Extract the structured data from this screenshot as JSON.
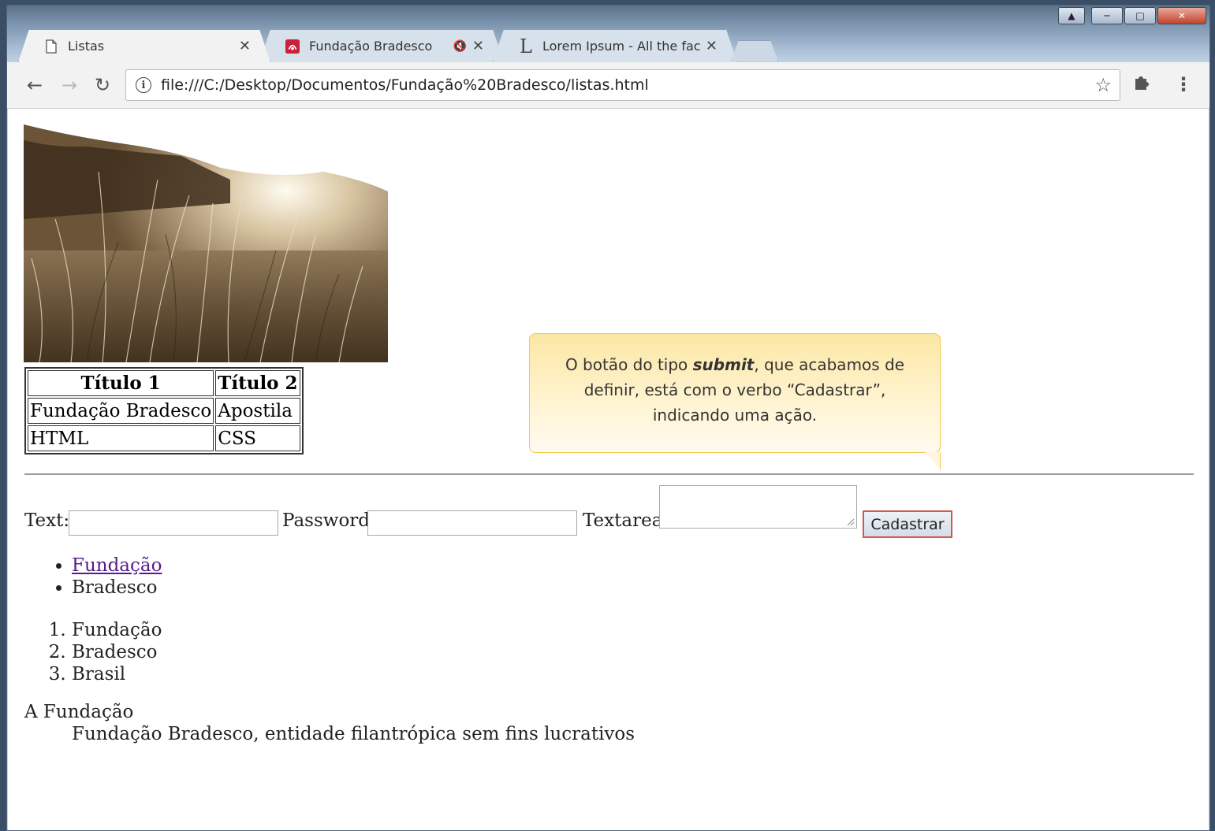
{
  "browser": {
    "tabs": [
      {
        "title": "Listas",
        "icon": "document-icon",
        "active": true
      },
      {
        "title": "Fundação Bradesco",
        "icon": "bradesco-icon",
        "muted": true
      },
      {
        "title": "Lorem Ipsum - All the fac",
        "icon": "lorem-l-icon"
      }
    ],
    "url": "file:///C:/Desktop/Documentos/Fundação%20Bradesco/listas.html"
  },
  "page": {
    "table": {
      "headers": [
        "Título 1",
        "Título 2"
      ],
      "rows": [
        [
          "Fundação Bradesco",
          "Apostila"
        ],
        [
          "HTML",
          "CSS"
        ]
      ]
    },
    "callout": {
      "before": "O botão do tipo ",
      "emphasis": "submit",
      "after": ", que acabamos de definir, está com o verbo “Cadastrar”, indicando uma ação."
    },
    "form": {
      "text_label": "Text:",
      "password_label": "Password:",
      "textarea_label": "Textarea:",
      "submit_label": "Cadastrar",
      "text_value": "",
      "password_value": "",
      "textarea_value": ""
    },
    "unordered_list": [
      {
        "text": "Fundação",
        "link": true
      },
      {
        "text": "Bradesco",
        "link": false
      }
    ],
    "ordered_list": [
      "Fundação",
      "Bradesco",
      "Brasil"
    ],
    "definition": {
      "term": "A Fundação",
      "description": "Fundação Bradesco, entidade filantrópica sem fins lucrativos"
    }
  },
  "colors": {
    "link_visited": "#551a8b",
    "callout_border": "#f2c94c",
    "submit_border": "#d9534f"
  }
}
